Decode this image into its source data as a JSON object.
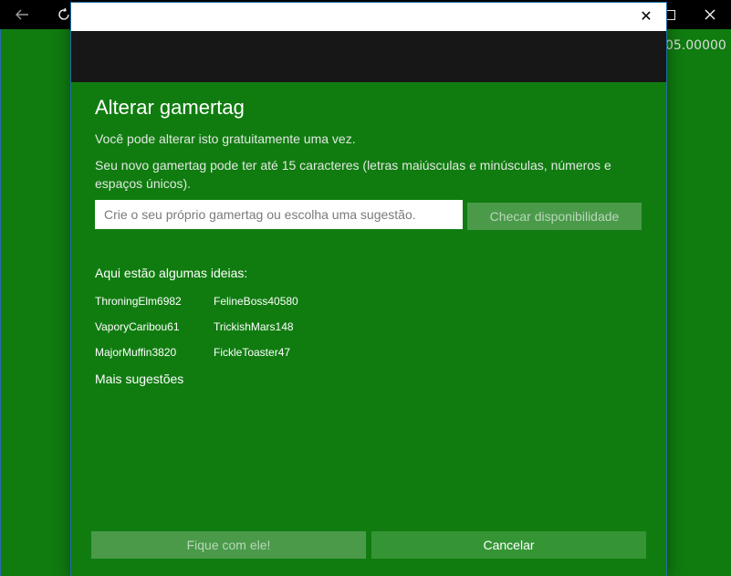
{
  "background": {
    "value_text": "05.00000",
    "accent_color": "#107c10"
  },
  "dialog": {
    "close_glyph": "✕",
    "title": "Alterar gamertag",
    "subtitle": "Você pode alterar isto gratuitamente uma vez.",
    "rules": "Seu novo gamertag pode ter até 15 caracteres (letras maiúsculas e minúsculas, números e espaços únicos).",
    "input": {
      "value": "",
      "placeholder": "Crie o seu próprio gamertag ou escolha uma sugestão."
    },
    "check_button_label": "Checar disponibilidade",
    "ideas_label": "Aqui estão algumas ideias:",
    "suggestions": [
      "ThroningElm6982",
      "FelineBoss40580",
      "VaporyCaribou61",
      "TrickishMars148",
      "MajorMuffin3820",
      "FickleToaster47"
    ],
    "more_suggestions_label": "Mais sugestões",
    "keep_button_label": "Fique com ele!",
    "cancel_button_label": "Cancelar"
  }
}
